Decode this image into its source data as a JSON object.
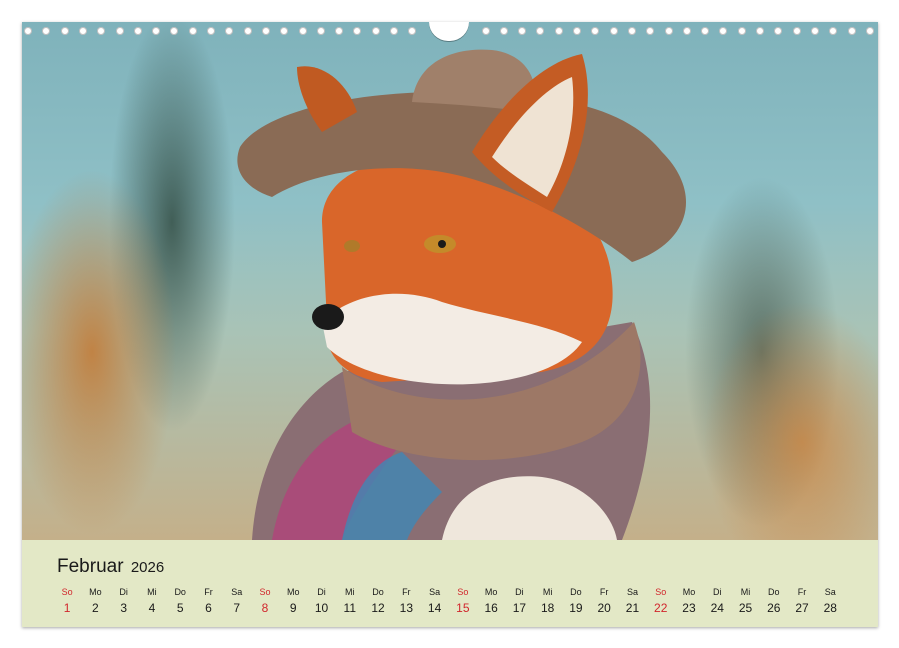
{
  "calendar": {
    "month": "Februar",
    "year": "2026",
    "days": [
      {
        "wd": "So",
        "num": "1",
        "sunday": true
      },
      {
        "wd": "Mo",
        "num": "2"
      },
      {
        "wd": "Di",
        "num": "3"
      },
      {
        "wd": "Mi",
        "num": "4"
      },
      {
        "wd": "Do",
        "num": "5"
      },
      {
        "wd": "Fr",
        "num": "6"
      },
      {
        "wd": "Sa",
        "num": "7"
      },
      {
        "wd": "So",
        "num": "8",
        "sunday": true
      },
      {
        "wd": "Mo",
        "num": "9"
      },
      {
        "wd": "Di",
        "num": "10"
      },
      {
        "wd": "Mi",
        "num": "11"
      },
      {
        "wd": "Do",
        "num": "12"
      },
      {
        "wd": "Fr",
        "num": "13"
      },
      {
        "wd": "Sa",
        "num": "14"
      },
      {
        "wd": "So",
        "num": "15",
        "sunday": true
      },
      {
        "wd": "Mo",
        "num": "16"
      },
      {
        "wd": "Di",
        "num": "17"
      },
      {
        "wd": "Mi",
        "num": "18"
      },
      {
        "wd": "Do",
        "num": "19"
      },
      {
        "wd": "Fr",
        "num": "20"
      },
      {
        "wd": "Sa",
        "num": "21"
      },
      {
        "wd": "So",
        "num": "22",
        "sunday": true
      },
      {
        "wd": "Mo",
        "num": "23"
      },
      {
        "wd": "Di",
        "num": "24"
      },
      {
        "wd": "Mi",
        "num": "25"
      },
      {
        "wd": "Do",
        "num": "26"
      },
      {
        "wd": "Fr",
        "num": "27"
      },
      {
        "wd": "Sa",
        "num": "28"
      }
    ]
  },
  "colors": {
    "sunday": "#d1262c",
    "calendar_bar": "#e3e8c6",
    "fox_fur": "#d9662a",
    "hat": "#8a6b55"
  },
  "photo": {
    "subject_icon": "fox-with-hat-and-scarf"
  }
}
